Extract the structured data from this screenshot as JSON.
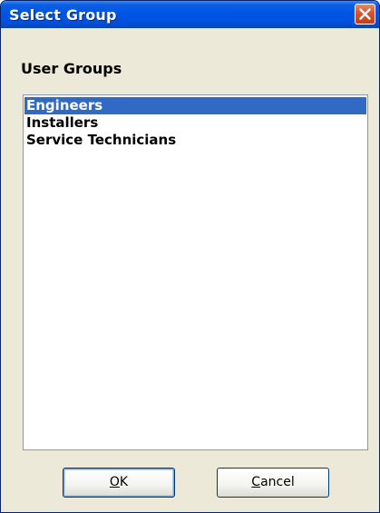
{
  "window": {
    "title": "Select Group"
  },
  "group_label": "User Groups",
  "list": {
    "items": [
      {
        "label": "Engineers",
        "selected": true
      },
      {
        "label": "Installers",
        "selected": false
      },
      {
        "label": "Service Technicians",
        "selected": false
      }
    ]
  },
  "buttons": {
    "ok": {
      "mnemonic": "O",
      "rest": "K"
    },
    "cancel": {
      "mnemonic": "C",
      "rest": "ancel"
    }
  },
  "colors": {
    "titlebar": "#0054e3",
    "selection": "#316ac5",
    "dialog_background": "#ece9d8",
    "close_button": "#d9532b"
  },
  "icons": {
    "close": "close-icon"
  }
}
